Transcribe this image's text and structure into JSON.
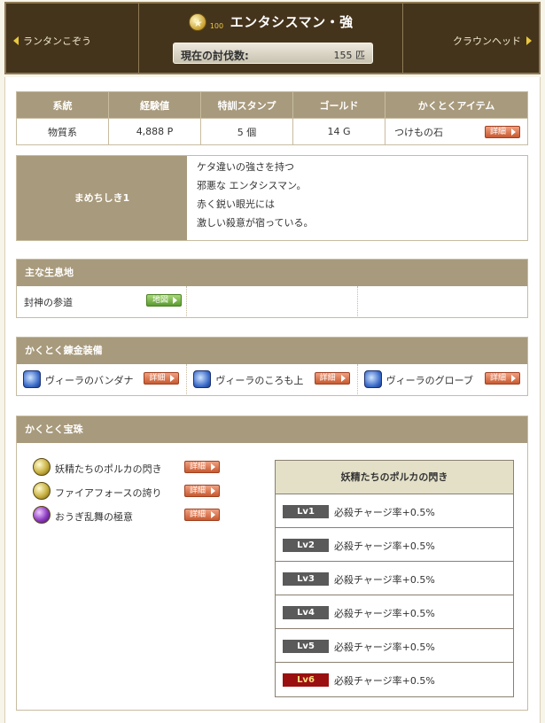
{
  "header": {
    "prev_label": "ランタンこぞう",
    "next_label": "クラウンヘッド",
    "star_glyph": "★",
    "level": "100",
    "monster_name": "エンタシスマン・強",
    "count_label": "現在の討伐数:",
    "count_value": "155 匹"
  },
  "stats": {
    "headers": [
      "系統",
      "経験値",
      "特訓スタンプ",
      "ゴールド",
      "かくとくアイテム"
    ],
    "values": [
      "物質系",
      "4,888 P",
      "5 個",
      "14 G"
    ],
    "item": "つけもの石",
    "detail_label": "詳細"
  },
  "description": {
    "title": "まめちしき1",
    "lines": [
      "ケタ違いの強さを持つ",
      "邪悪な エンタシスマン。",
      "赤く鋭い眼光には",
      "激しい殺意が宿っている。"
    ]
  },
  "habitat": {
    "title": "主な生息地",
    "place": "封神の参道",
    "map_label": "地図"
  },
  "equipment": {
    "title": "かくとく錬金装備",
    "detail_label": "詳細",
    "items": [
      "ヴィーラのバンダナ",
      "ヴィーラのころも上",
      "ヴィーラのグローブ"
    ]
  },
  "jewels": {
    "title": "かくとく宝珠",
    "detail_label": "詳細",
    "items": [
      {
        "name": "妖精たちのポルカの閃き",
        "color": "gold"
      },
      {
        "name": "ファイアフォースの誇り",
        "color": "gold"
      },
      {
        "name": "おうぎ乱舞の極意",
        "color": "purple"
      }
    ],
    "selected_title": "妖精たちのポルカの閃き",
    "levels": [
      {
        "lv": "Lv1",
        "effect": "必殺チャージ率+0.5%"
      },
      {
        "lv": "Lv2",
        "effect": "必殺チャージ率+0.5%"
      },
      {
        "lv": "Lv3",
        "effect": "必殺チャージ率+0.5%"
      },
      {
        "lv": "Lv4",
        "effect": "必殺チャージ率+0.5%"
      },
      {
        "lv": "Lv5",
        "effect": "必殺チャージ率+0.5%"
      },
      {
        "lv": "Lv6",
        "effect": "必殺チャージ率+0.5%"
      }
    ]
  },
  "colors": {
    "header_bg": "#45341c",
    "section_head": "#a89a7c",
    "detail_button": "#c85a30",
    "map_button": "#5a9a30",
    "lv6_badge": "#9a1010"
  }
}
